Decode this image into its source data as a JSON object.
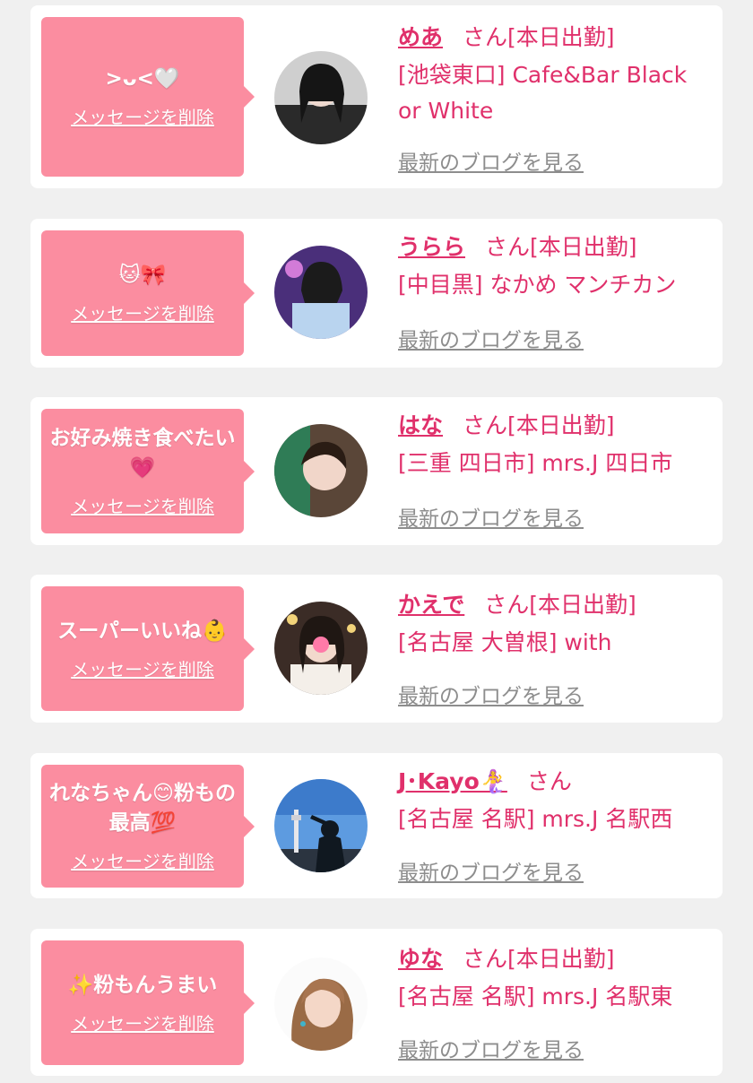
{
  "cards": [
    {
      "message": ">ᴗ<🤍",
      "delete_label": "メッセージを削除",
      "name": "めあ",
      "suffix": "さん[本日出勤]",
      "shop": "[池袋東口] Cafe&Bar Black or White",
      "blog_label": "最新のブログを見る"
    },
    {
      "message": "🐱🎀",
      "delete_label": "メッセージを削除",
      "name": "うらら",
      "suffix": "さん[本日出勤]",
      "shop": "[中目黒] なかめ マンチカン",
      "blog_label": "最新のブログを見る"
    },
    {
      "message": "お好み焼き食べたい💗",
      "delete_label": "メッセージを削除",
      "name": "はな",
      "suffix": "さん[本日出勤]",
      "shop": "[三重 四日市] mrs.J 四日市",
      "blog_label": "最新のブログを見る"
    },
    {
      "message": "スーパーいいね👶",
      "delete_label": "メッセージを削除",
      "name": "かえで",
      "suffix": "さん[本日出勤]",
      "shop": "[名古屋 大曽根] with",
      "blog_label": "最新のブログを見る"
    },
    {
      "message": "れなちゃん😊粉もの最高💯",
      "delete_label": "メッセージを削除",
      "name": "J･Kayo🧜‍♀️",
      "suffix": "さん",
      "shop": "[名古屋 名駅] mrs.J 名駅西",
      "blog_label": "最新のブログを見る"
    },
    {
      "message": "✨粉もんうまい",
      "delete_label": "メッセージを削除",
      "name": "ゆな",
      "suffix": "さん[本日出勤]",
      "shop": "[名古屋 名駅] mrs.J 名駅東",
      "blog_label": "最新のブログを見る"
    }
  ],
  "colors": {
    "accent": "#e0306b",
    "bubble": "#fb8da0",
    "link_gray": "#8d8d8d",
    "background": "#f0f0f0"
  }
}
